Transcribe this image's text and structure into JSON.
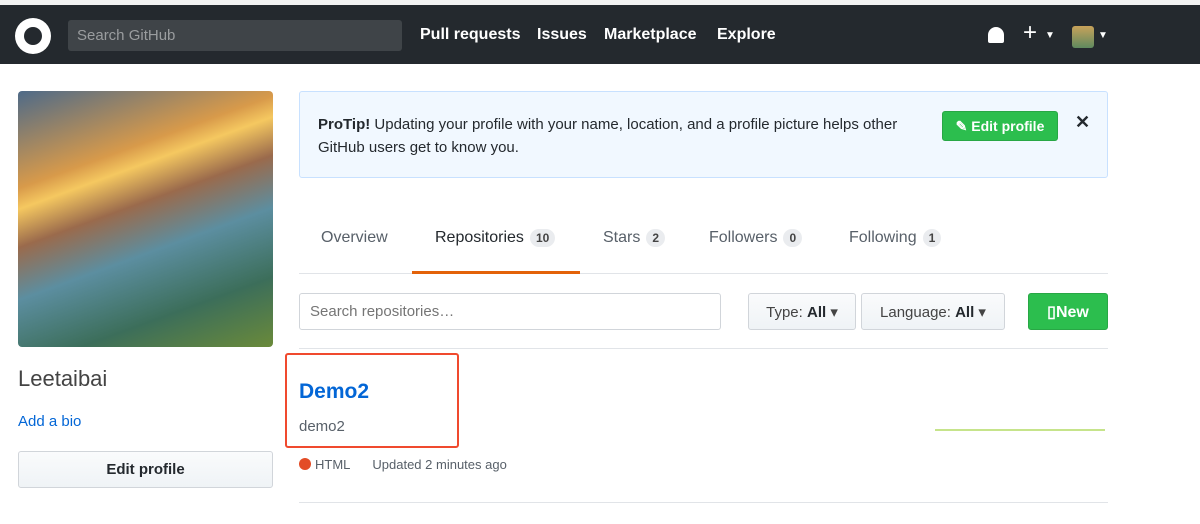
{
  "header": {
    "search_placeholder": "Search GitHub",
    "links": [
      "Pull requests",
      "Issues",
      "Marketplace",
      "Explore"
    ]
  },
  "profile": {
    "name": "Leetaibai",
    "add_bio": "Add a bio",
    "edit_profile": "Edit profile"
  },
  "protip": {
    "title": "ProTip!",
    "text": " Updating your profile with your name, location, and a profile picture helps other GitHub users get to know you.",
    "button": "Edit profile",
    "close": "✕"
  },
  "tabs": [
    {
      "label": "Overview"
    },
    {
      "label": "Repositories",
      "count": "10"
    },
    {
      "label": "Stars",
      "count": "2"
    },
    {
      "label": "Followers",
      "count": "0"
    },
    {
      "label": "Following",
      "count": "1"
    }
  ],
  "filters": {
    "search_placeholder": "Search repositories…",
    "type_label": "Type:",
    "type_value": "All",
    "language_label": "Language:",
    "language_value": "All",
    "new_button": "New"
  },
  "repos": [
    {
      "name": "Demo2",
      "description": "demo2",
      "language": "HTML",
      "language_color": "#e34c26",
      "updated": "Updated 2 minutes ago"
    }
  ]
}
